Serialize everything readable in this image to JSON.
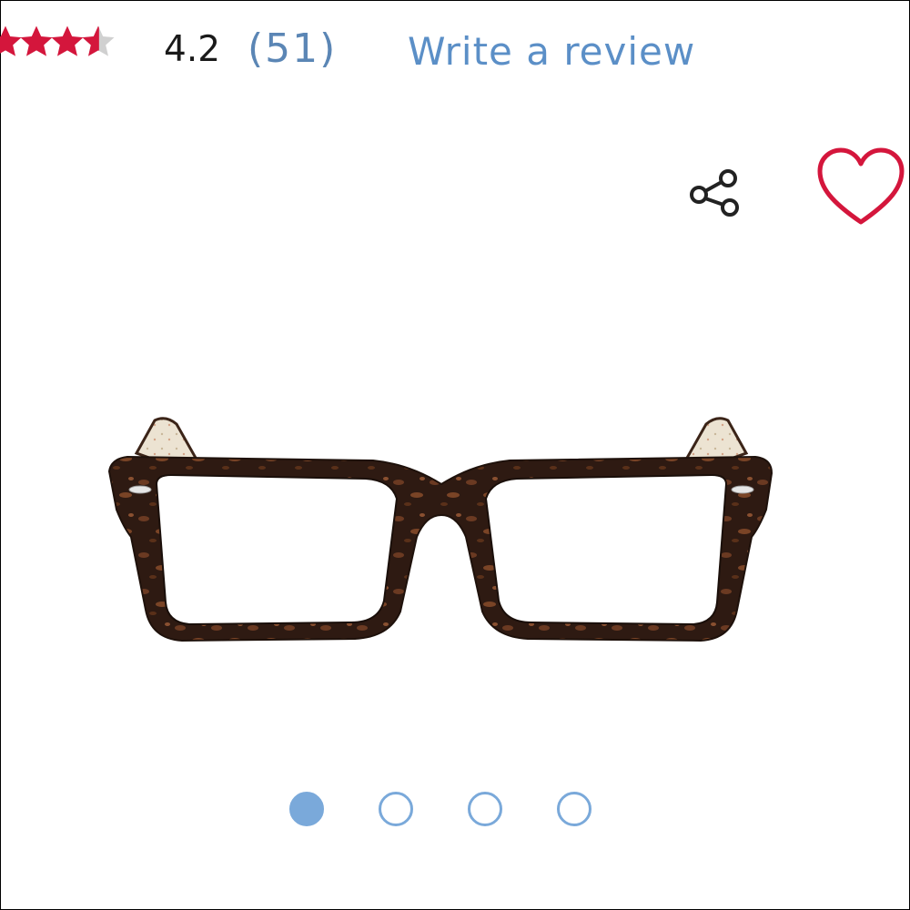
{
  "rating": {
    "value": "4.2",
    "score": 4.2,
    "max": 5,
    "count_label": "(51)",
    "filled_color": "#d4163c",
    "empty_color": "#d0d0d0"
  },
  "actions": {
    "write_review_label": "Write a review",
    "share_icon": "share-icon",
    "favorite_icon": "heart-icon",
    "favorite_color": "#d4163c",
    "link_color": "#5b8fc7"
  },
  "product_image": {
    "description_icon": "eyeglasses-product-image",
    "frame_color": "#3a2016",
    "temple_color": "#e8ddc8"
  },
  "carousel": {
    "total": 4,
    "active_index": 0,
    "accent_color": "#7aa9da"
  }
}
